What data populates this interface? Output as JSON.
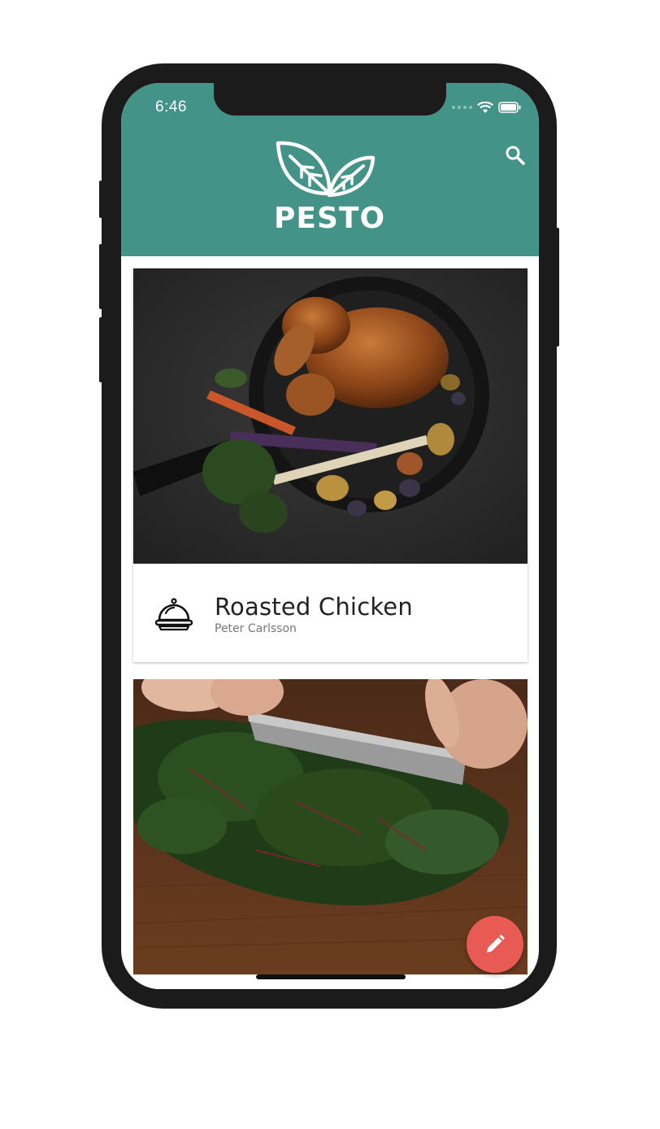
{
  "status_bar": {
    "time": "6:46"
  },
  "app": {
    "name": "PESTO",
    "brand_color": "#439388",
    "accent_color": "#e85a54"
  },
  "icons": {
    "search": "search-icon",
    "dish": "cloche-icon",
    "edit": "pencil-icon"
  },
  "recipes": [
    {
      "title": "Roasted Chicken",
      "author": "Peter Carlsson",
      "image": "roasted-chicken-photo"
    },
    {
      "title": "",
      "author": "",
      "image": "chopped-chard-photo"
    }
  ]
}
